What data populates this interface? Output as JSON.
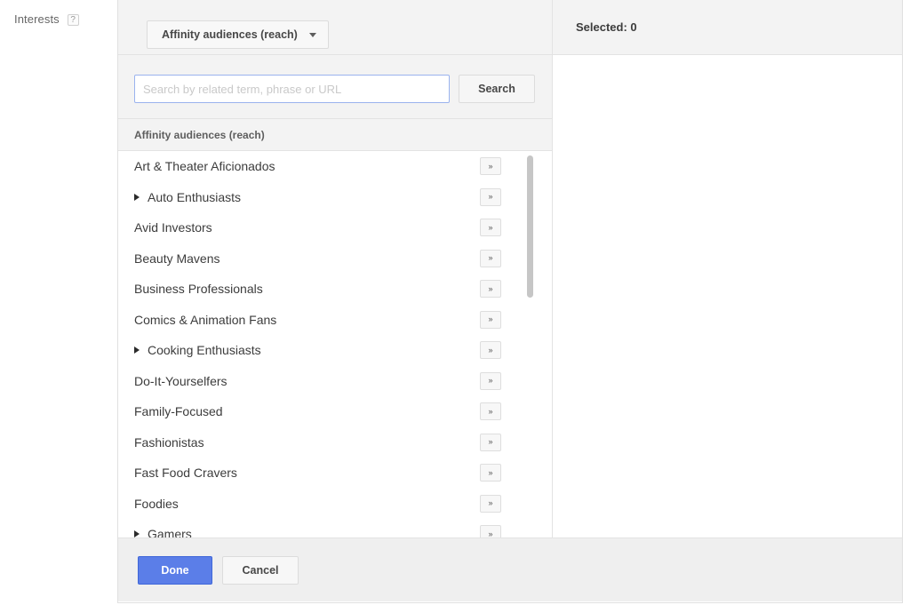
{
  "field": {
    "label": "Interests",
    "help_icon": "help-question-icon",
    "help_text": "?"
  },
  "type_selector": {
    "label": "Affinity audiences (reach)",
    "caret_icon": "chevron-down-icon"
  },
  "search": {
    "value": "",
    "placeholder": "Search by related term, phrase or URL",
    "button_label": "Search"
  },
  "list": {
    "section_title": "Affinity audiences (reach)",
    "drill_glyph": "»",
    "items": [
      {
        "label": "Art & Theater Aficionados",
        "expandable": false
      },
      {
        "label": "Auto Enthusiasts",
        "expandable": true
      },
      {
        "label": "Avid Investors",
        "expandable": false
      },
      {
        "label": "Beauty Mavens",
        "expandable": false
      },
      {
        "label": "Business Professionals",
        "expandable": false
      },
      {
        "label": "Comics & Animation Fans",
        "expandable": false
      },
      {
        "label": "Cooking Enthusiasts",
        "expandable": true
      },
      {
        "label": "Do-It-Yourselfers",
        "expandable": false
      },
      {
        "label": "Family-Focused",
        "expandable": false
      },
      {
        "label": "Fashionistas",
        "expandable": false
      },
      {
        "label": "Fast Food Cravers",
        "expandable": false
      },
      {
        "label": "Foodies",
        "expandable": false
      },
      {
        "label": "Gamers",
        "expandable": true
      }
    ]
  },
  "selected_panel": {
    "title": "Selected: 0"
  },
  "footer": {
    "done_label": "Done",
    "cancel_label": "Cancel"
  },
  "colors": {
    "primary": "#5b7ee8",
    "panel_bg": "#f3f3f3",
    "footer_bg": "#efefef",
    "border": "#e3e3e3",
    "input_focus_border": "#9ab3ee"
  }
}
